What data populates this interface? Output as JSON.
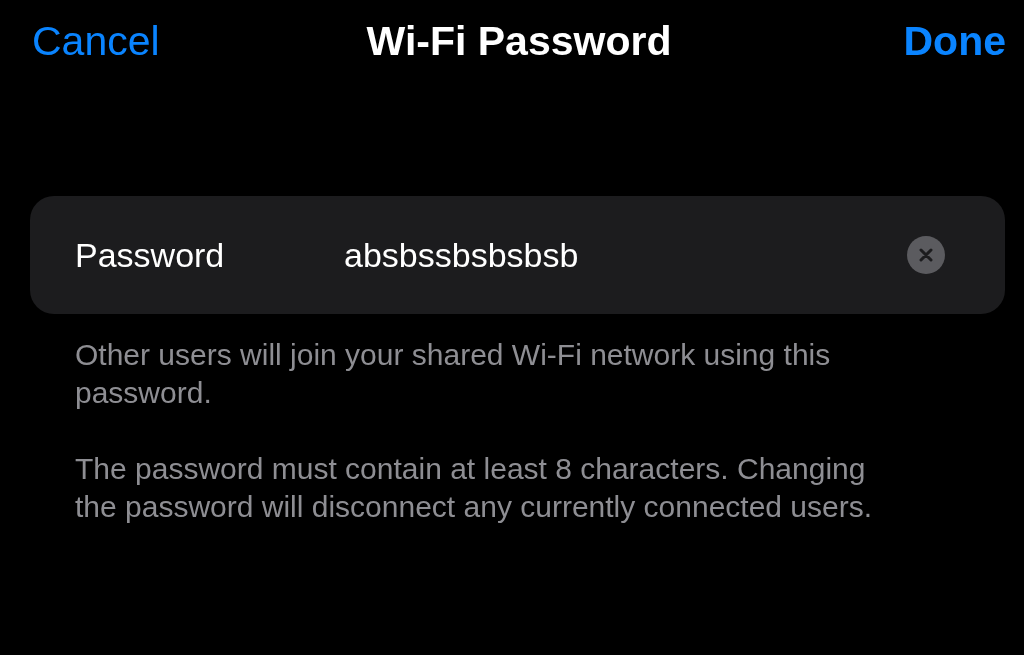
{
  "nav_bar": {
    "cancel": "Cancel",
    "title": "Wi-Fi Password",
    "done": "Done"
  },
  "password_field": {
    "label": "Password",
    "value": "absbssbsbsbsb"
  },
  "footer_notes": [
    "Other users will join your shared Wi-Fi network using this password.",
    "The password must contain at least 8 characters. Changing the password will disconnect any currently connected users."
  ]
}
